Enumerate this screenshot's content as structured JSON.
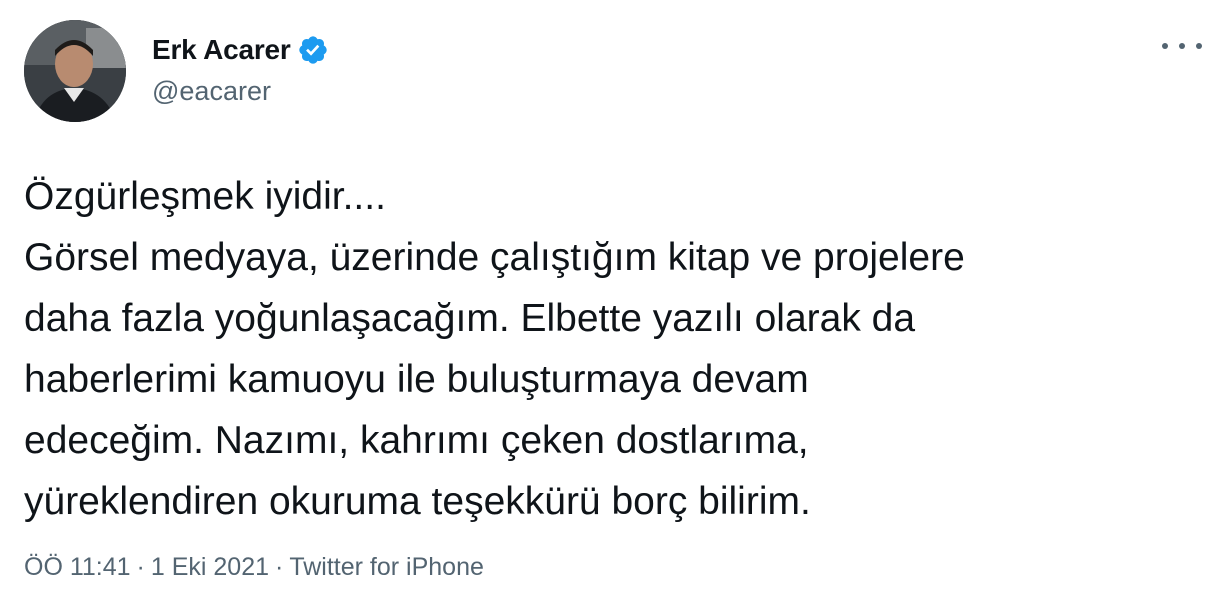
{
  "author": {
    "display_name": "Erk Acarer",
    "handle": "@eacarer",
    "verified_icon": "verified-badge-icon",
    "verified_color": "#1d9bf0"
  },
  "tweet": {
    "text": "Özgürleşmek iyidir....\nGörsel medyaya, üzerinde çalıştığım kitap ve projelere\ndaha fazla yoğunlaşacağım. Elbette yazılı olarak da\nhaberlerimi kamuoyu ile buluşturmaya devam\nedeceğim. Nazımı, kahrımı çeken dostlarıma,\nyüreklendiren okuruma teşekkürü borç bilirim.",
    "time": "ÖÖ 11:41",
    "separator": "·",
    "date": "1 Eki 2021",
    "source": "Twitter for iPhone"
  },
  "icons": {
    "more": "more-options-icon"
  },
  "colors": {
    "text_primary": "#0f1419",
    "text_secondary": "#536471",
    "accent": "#1d9bf0"
  }
}
